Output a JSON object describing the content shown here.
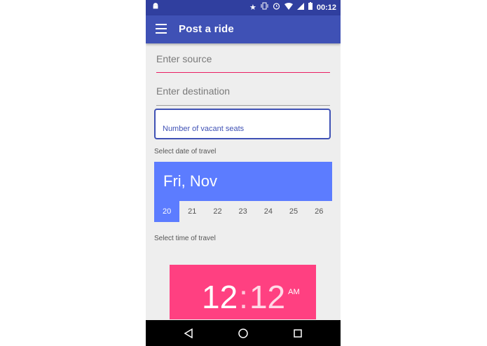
{
  "status_bar": {
    "time": "00:12",
    "icons": [
      "android-debug-icon",
      "star-icon",
      "vibrate-icon",
      "alarm-icon",
      "wifi-icon",
      "signal-icon",
      "battery-icon"
    ]
  },
  "app_bar": {
    "title": "Post a ride",
    "menu_icon": "hamburger-menu-icon"
  },
  "form": {
    "source_placeholder": "Enter source",
    "destination_placeholder": "Enter destination",
    "seats_placeholder": "Number of vacant seats",
    "date_label": "Select date of travel",
    "time_label": "Select time of travel"
  },
  "date_picker": {
    "header": "Fri, Nov",
    "days": [
      "20",
      "21",
      "22",
      "23",
      "24",
      "25",
      "26"
    ],
    "selected_day": "20"
  },
  "time_picker": {
    "hour": "12",
    "separator": ":",
    "minute": "12",
    "ampm": "AM"
  },
  "nav_bar": {
    "back_icon": "back-triangle-icon",
    "home_icon": "home-circle-icon",
    "recents_icon": "recents-square-icon"
  },
  "colors": {
    "status_bar": "#303f9f",
    "app_bar": "#3f51b5",
    "date_accent": "#5c7cff",
    "time_accent": "#ff4081",
    "focus_line": "#e91e63"
  }
}
